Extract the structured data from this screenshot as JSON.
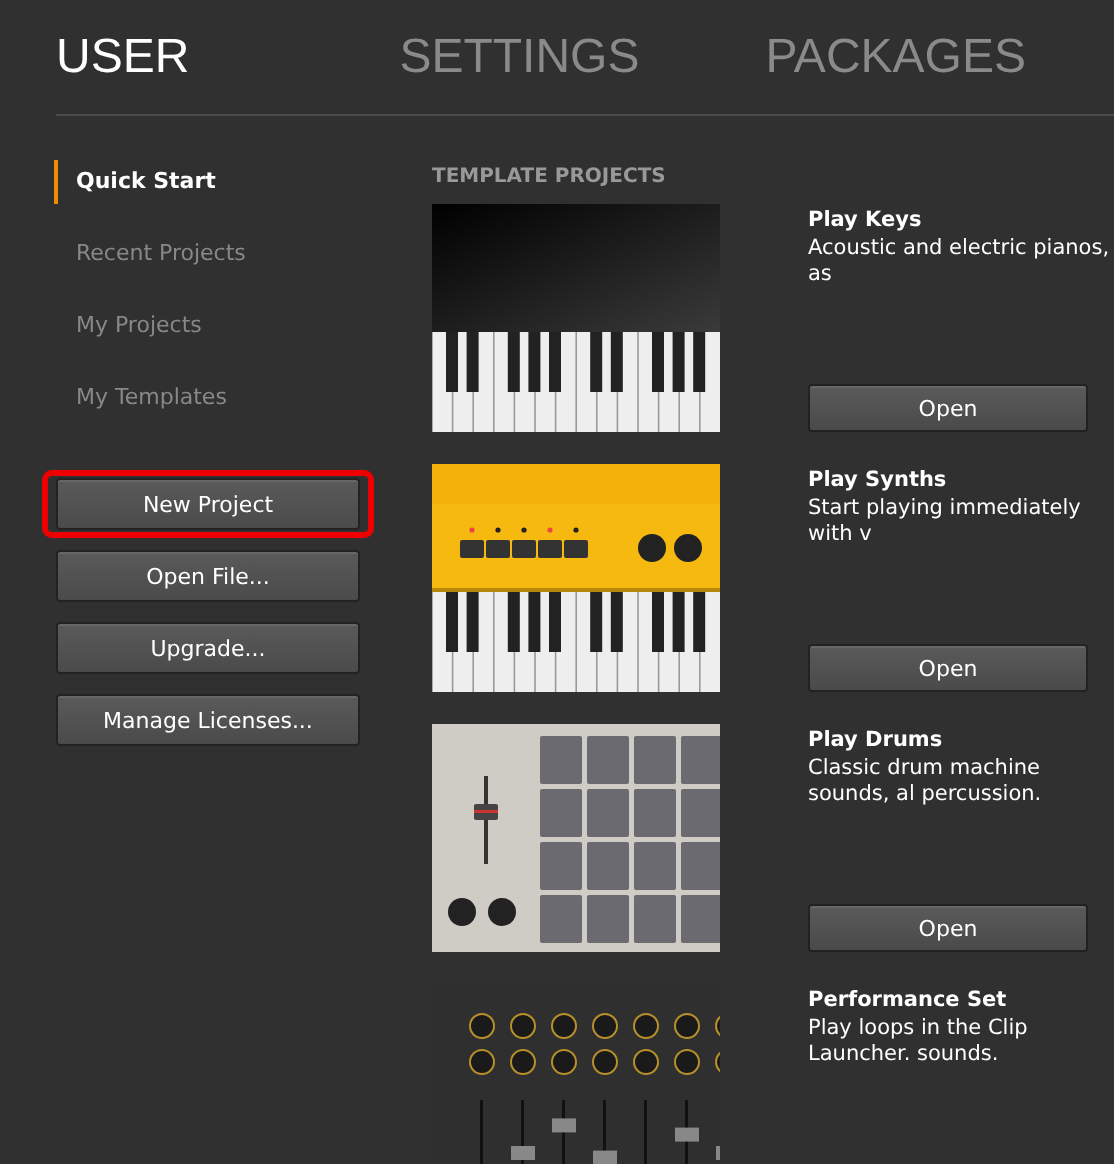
{
  "tabs": [
    {
      "label": "USER",
      "selected": true
    },
    {
      "label": "SETTINGS",
      "selected": false
    },
    {
      "label": "PACKAGES",
      "selected": false
    }
  ],
  "sidebar": {
    "items": [
      {
        "label": "Quick Start",
        "selected": true
      },
      {
        "label": "Recent Projects",
        "selected": false
      },
      {
        "label": "My Projects",
        "selected": false
      },
      {
        "label": "My Templates",
        "selected": false
      }
    ],
    "buttons": [
      {
        "label": "New Project",
        "highlighted": true
      },
      {
        "label": "Open File...",
        "highlighted": false
      },
      {
        "label": "Upgrade...",
        "highlighted": false
      },
      {
        "label": "Manage Licenses...",
        "highlighted": false
      }
    ]
  },
  "section_title": "TEMPLATE PROJECTS",
  "templates": [
    {
      "kind": "keys",
      "title": "Play Keys",
      "description": "Acoustic and electric pianos, as",
      "button": "Open"
    },
    {
      "kind": "synth",
      "title": "Play Synths",
      "description": "Start playing immediately with v",
      "button": "Open"
    },
    {
      "kind": "drums",
      "title": "Play Drums",
      "description": "Classic drum machine sounds, al percussion.",
      "button": "Open"
    },
    {
      "kind": "mixer",
      "title": "Performance Set",
      "description": "Play loops in the Clip Launcher. sounds."
    }
  ]
}
